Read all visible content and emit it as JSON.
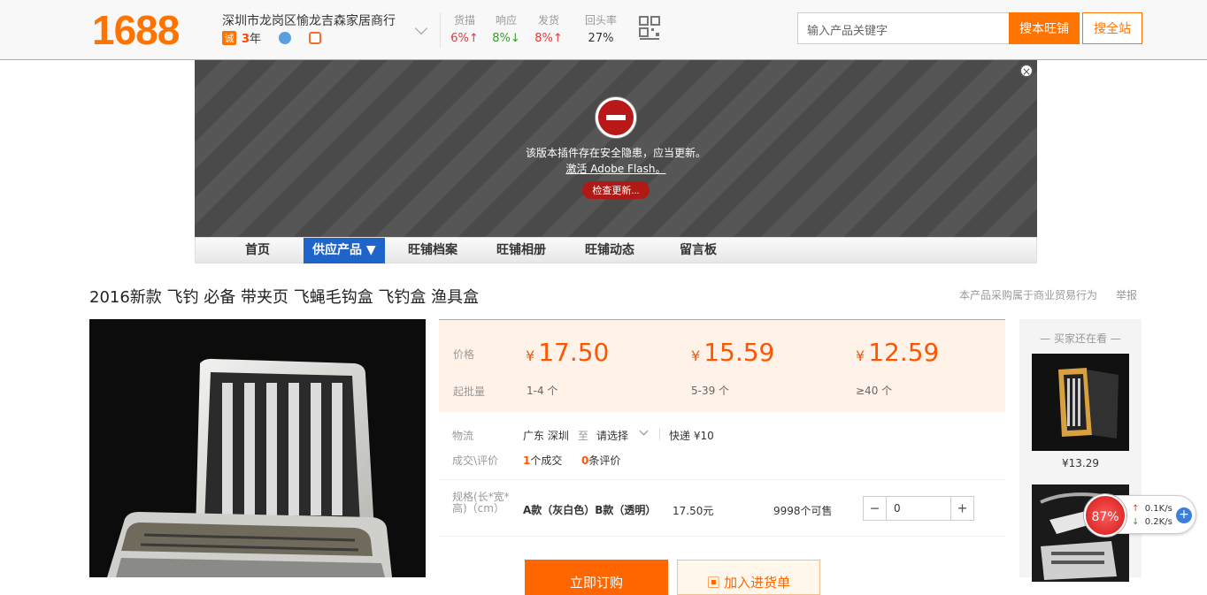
{
  "header": {
    "logo": "1688",
    "shop_name": "深圳市龙岗区愉龙吉森家居商行",
    "badge": "诚",
    "years_num": "3",
    "years_unit": "年",
    "stats": [
      {
        "label": "货描",
        "value": "6%↑"
      },
      {
        "label": "响应",
        "value": "8%↓"
      },
      {
        "label": "发货",
        "value": "8%↑"
      },
      {
        "label": "回头率",
        "value": "27%"
      }
    ],
    "search_placeholder": "输入产品关键字",
    "search_shop_btn": "搜本旺铺",
    "search_site_btn": "搜全站"
  },
  "flash": {
    "message": "该版本插件存在安全隐患，应当更新。",
    "link": "激活 Adobe Flash。",
    "button": "检查更新..."
  },
  "nav": {
    "items": [
      "首页",
      "供应产品 ▼",
      "旺铺档案",
      "旺铺相册",
      "旺铺动态",
      "留言板"
    ]
  },
  "product": {
    "title": "2016新款 飞钓 必备 带夹页 飞蝇毛钩盒 飞钓盒 渔具盒",
    "notice": "本产品采购属于商业贸易行为",
    "report": "举报"
  },
  "pricing": {
    "price_label": "价格",
    "min_label": "起批量",
    "currency": "¥",
    "tiers": [
      {
        "price": "17.50",
        "qty": "1-4 个"
      },
      {
        "price": "15.59",
        "qty": "5-39 个"
      },
      {
        "price": "12.59",
        "qty": "≥40 个"
      }
    ]
  },
  "logistics": {
    "label": "物流",
    "from": "广东 深圳",
    "to_word": "至",
    "select": "请选择",
    "express": "快递 ¥10"
  },
  "deals": {
    "label": "成交\\评价",
    "deal_count": "1",
    "deal_text": "个成交",
    "review_count": "0",
    "review_text": "条评价"
  },
  "spec": {
    "label": "规格(长*宽*高)（cm）",
    "name": "A款（灰白色）B款（透明）",
    "price": "17.50元",
    "stock": "9998个可售",
    "minus": "−",
    "plus": "+",
    "quantity": "0"
  },
  "actions": {
    "buy": "立即订购",
    "cart": "加入进货单"
  },
  "rail": {
    "title": "买家还在看",
    "items": [
      {
        "price": "¥13.29"
      }
    ]
  },
  "speed_widget": {
    "percent": "87%",
    "up": "0.1K/s",
    "down": "0.2K/s",
    "plus": "+"
  }
}
